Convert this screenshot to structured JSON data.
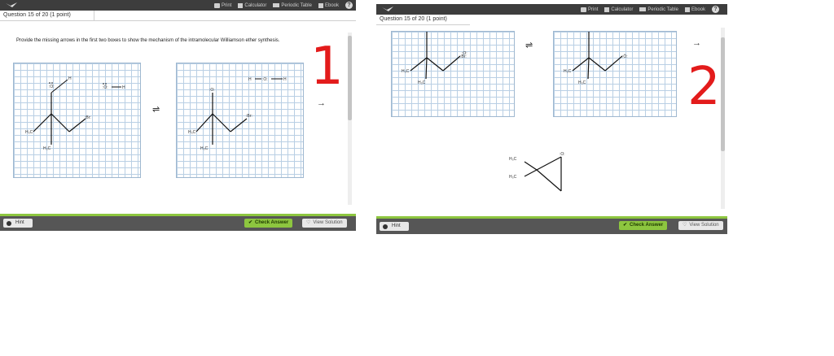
{
  "toolbar": {
    "print": "Print",
    "calculator": "Calculator",
    "periodic_table": "Periodic Table",
    "ebook": "Ebook",
    "help_icon": "?"
  },
  "question_header": "Question 15 of 20 (1 point)",
  "prompt": "Provide the missing arrows in the first two boxes to show the mechanism of the intramolecular Williamson ether synthesis.",
  "footer": {
    "hint": "Hint",
    "check_answer": "Check Answer",
    "view_solution": "View Solution"
  },
  "screenshot_1": {
    "annotation": "1",
    "equilibrium_arrow": "⇌",
    "reaction_arrow": "→",
    "box1_labels": {
      "methyl_top": "H₃C",
      "methyl_bottom": "H₃C",
      "h": "H",
      "h_right": "H"
    },
    "box2_labels": {
      "methyl_top": "H₃C",
      "methyl_bottom": "H₃C",
      "h_left": "H",
      "h_right": "H"
    }
  },
  "screenshot_2": {
    "annotation": "2",
    "equilibrium_arrow": "⇌",
    "reaction_arrow": "→",
    "labels": {
      "box3_top": "H₃C",
      "box3_bottom": "H₃C",
      "box4_top": "H₃C",
      "box4_bottom": "H₃C",
      "product_top": "H₃C",
      "product_bottom": "H₃C"
    }
  },
  "colors": {
    "topbar": "#3d3d3d",
    "accent_green": "#8dc63f",
    "annotation_red": "#e31b1b",
    "grid_line": "#b9cfe4"
  }
}
